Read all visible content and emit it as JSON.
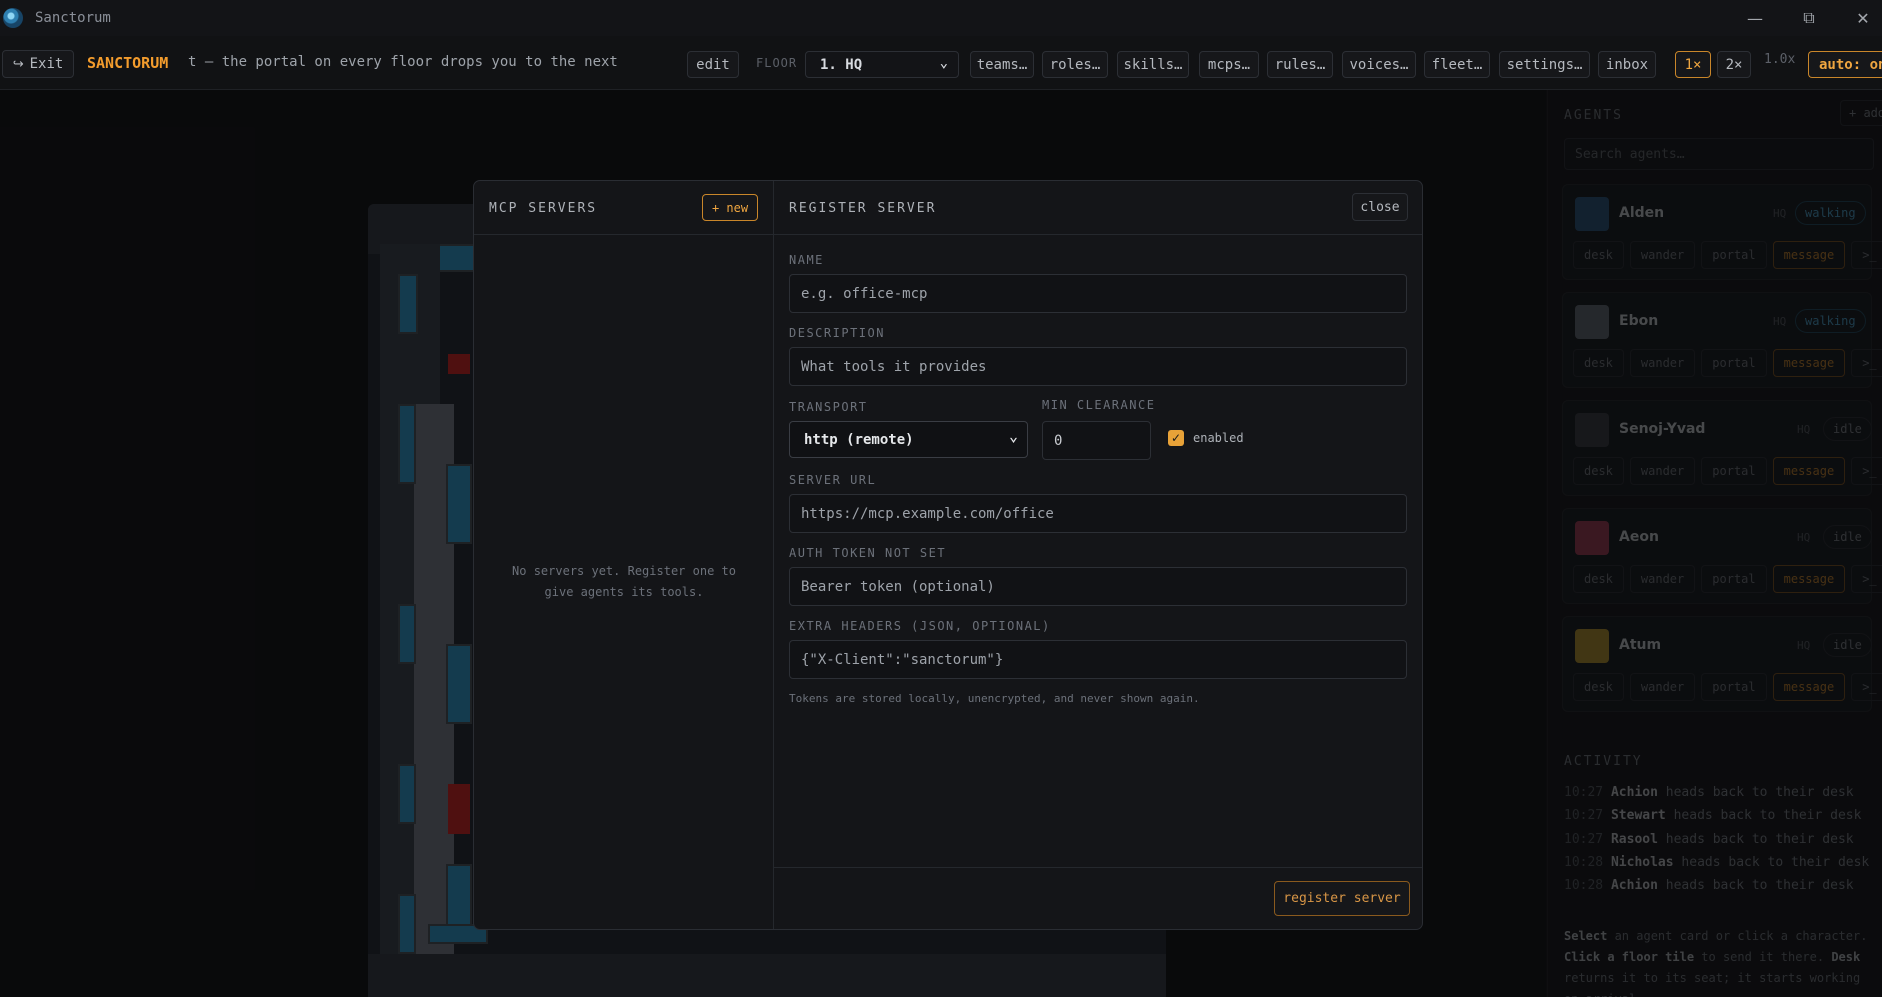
{
  "window": {
    "title": "Sanctorum"
  },
  "toolbar": {
    "exit_label": "Exit",
    "brand": "SANCTORUM",
    "marquee": "t — the portal on every floor drops you to the next",
    "edit_label": "edit",
    "floor_label": "FLOOR",
    "floor_value": "1. HQ",
    "menus": [
      "teams…",
      "roles…",
      "skills…",
      "mcps…",
      "rules…",
      "voices…",
      "fleet…",
      "settings…",
      "inbox"
    ],
    "speed_1x": "1×",
    "speed_2x": "2×",
    "speed_readout": "1.0x",
    "auto_label": "auto: on"
  },
  "right_panel": {
    "agents_title": "AGENTS",
    "add_label": "+ add",
    "search_placeholder": "Search agents…",
    "agents": [
      {
        "name": "Alden",
        "floor": "HQ",
        "status": "walking",
        "avatar_color": "#2c5e8a"
      },
      {
        "name": "Ebon",
        "floor": "HQ",
        "status": "walking",
        "avatar_color": "#6d7580"
      },
      {
        "name": "Senoj-Yvad",
        "floor": "HQ",
        "status": "idle",
        "avatar_color": "#3b3f46"
      },
      {
        "name": "Aeon",
        "floor": "HQ",
        "status": "idle",
        "avatar_color": "#b0405c"
      },
      {
        "name": "Atum",
        "floor": "HQ",
        "status": "idle",
        "avatar_color": "#c9a22e"
      }
    ],
    "agent_actions": [
      "desk",
      "wander",
      "portal",
      "message",
      ">_"
    ],
    "activity_title": "ACTIVITY",
    "activity": [
      {
        "time": "10:27",
        "who": "Achion",
        "what": "heads back to their desk"
      },
      {
        "time": "10:27",
        "who": "Stewart",
        "what": "heads back to their desk"
      },
      {
        "time": "10:27",
        "who": "Rasool",
        "what": "heads back to their desk"
      },
      {
        "time": "10:28",
        "who": "Nicholas",
        "what": "heads back to their desk"
      },
      {
        "time": "10:28",
        "who": "Achion",
        "what": "heads back to their desk"
      }
    ],
    "hint": {
      "select": "Select",
      "part1": " an agent card or click a character.",
      "click_floor": "Click a floor tile",
      "part2": " to send it there. ",
      "desk": "Desk",
      "part3": " returns it to its seat; it starts working on arrival."
    }
  },
  "modal": {
    "left_title": "MCP SERVERS",
    "new_label": "+ new",
    "empty_text": "No servers yet. Register one to give agents its tools.",
    "right_title": "REGISTER SERVER",
    "close_label": "close",
    "name_label": "NAME",
    "name_placeholder": "e.g. office-mcp",
    "description_label": "DESCRIPTION",
    "description_placeholder": "What tools it provides",
    "transport_label": "TRANSPORT",
    "transport_value": "http (remote)",
    "clearance_label": "MIN CLEARANCE",
    "clearance_value": "0",
    "enabled_label": "enabled",
    "enabled_checked": true,
    "url_label": "SERVER URL",
    "url_placeholder": "https://mcp.example.com/office",
    "auth_label": "AUTH TOKEN NOT SET",
    "auth_placeholder": "Bearer token (optional)",
    "headers_label": "EXTRA HEADERS (JSON, OPTIONAL)",
    "headers_placeholder": "{\"X-Client\":\"sanctorum\"}",
    "note": "Tokens are stored locally, unencrypted, and never shown again.",
    "submit_label": "register server"
  }
}
